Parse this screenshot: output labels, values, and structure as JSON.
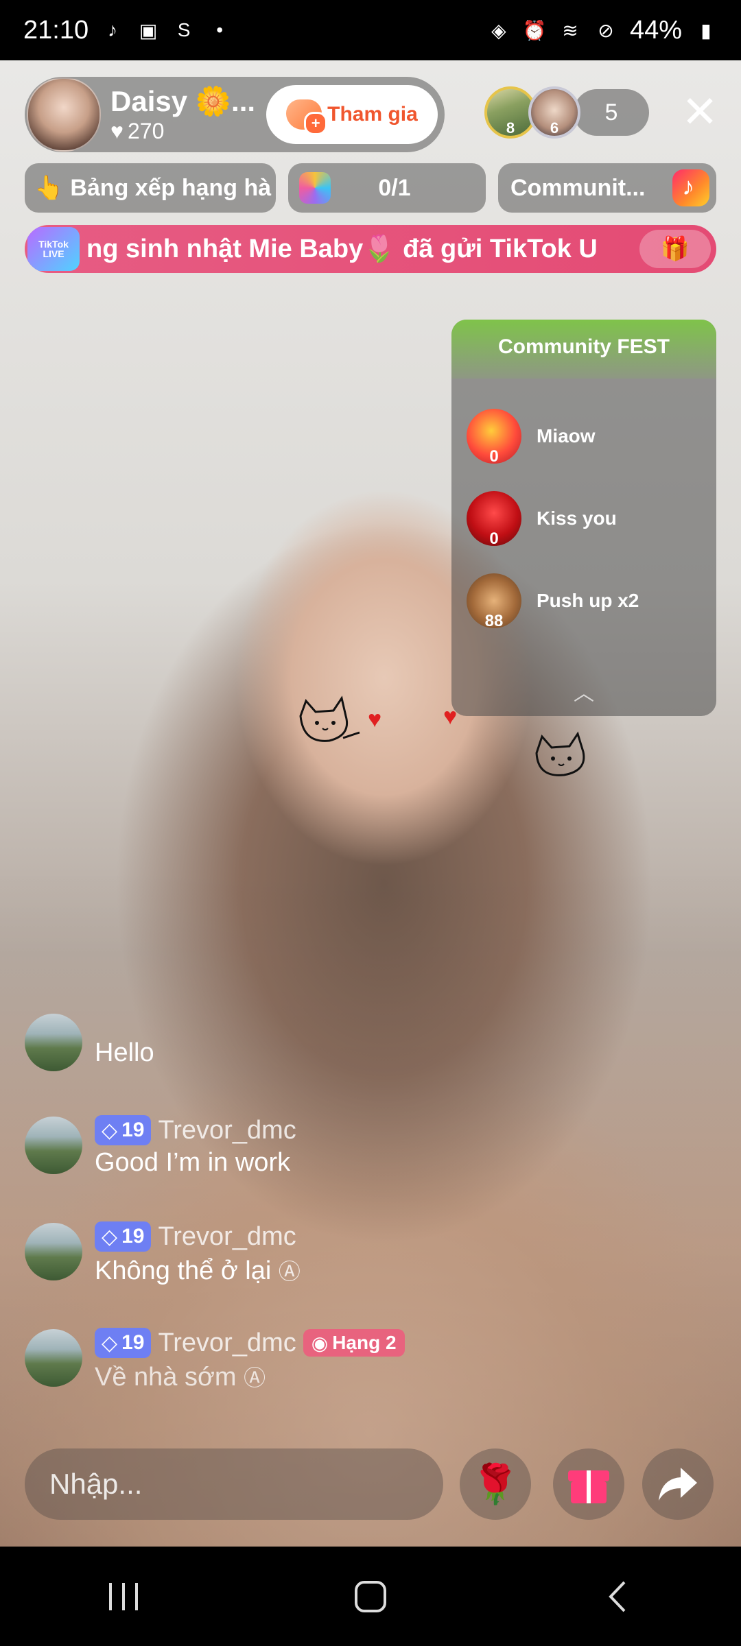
{
  "status_bar": {
    "time": "21:10",
    "battery": "44%"
  },
  "host": {
    "name": "Daisy 🌼...",
    "likes": "270",
    "join_label": "Tham gia"
  },
  "viewers": {
    "top1_count": "8",
    "top2_count": "6",
    "total": "5"
  },
  "info_row": {
    "ranking_label": "Bảng xếp hạng hà",
    "goal_progress": "0/1",
    "community_label": "Communit..."
  },
  "banner": {
    "badge_text": "TikTok LIVE",
    "text": "ng sinh nhật Mie Baby🌷 đã gửi TikTok U"
  },
  "community_fest": {
    "title": "Community FEST",
    "items": [
      {
        "name": "Miaow",
        "count": "0"
      },
      {
        "name": "Kiss you",
        "count": "0"
      },
      {
        "name": "Push up x2",
        "count": "88"
      }
    ]
  },
  "chat": {
    "messages": [
      {
        "text": "Hello"
      },
      {
        "level": "19",
        "user": "Trevor_dmc",
        "text": "Good I’m in work"
      },
      {
        "level": "19",
        "user": "Trevor_dmc",
        "text": "Không thể ở lại"
      },
      {
        "level": "19",
        "user": "Trevor_dmc",
        "badge": "Hạng 2",
        "text": "Về nhà sớm"
      }
    ]
  },
  "input": {
    "placeholder": "Nhập..."
  }
}
